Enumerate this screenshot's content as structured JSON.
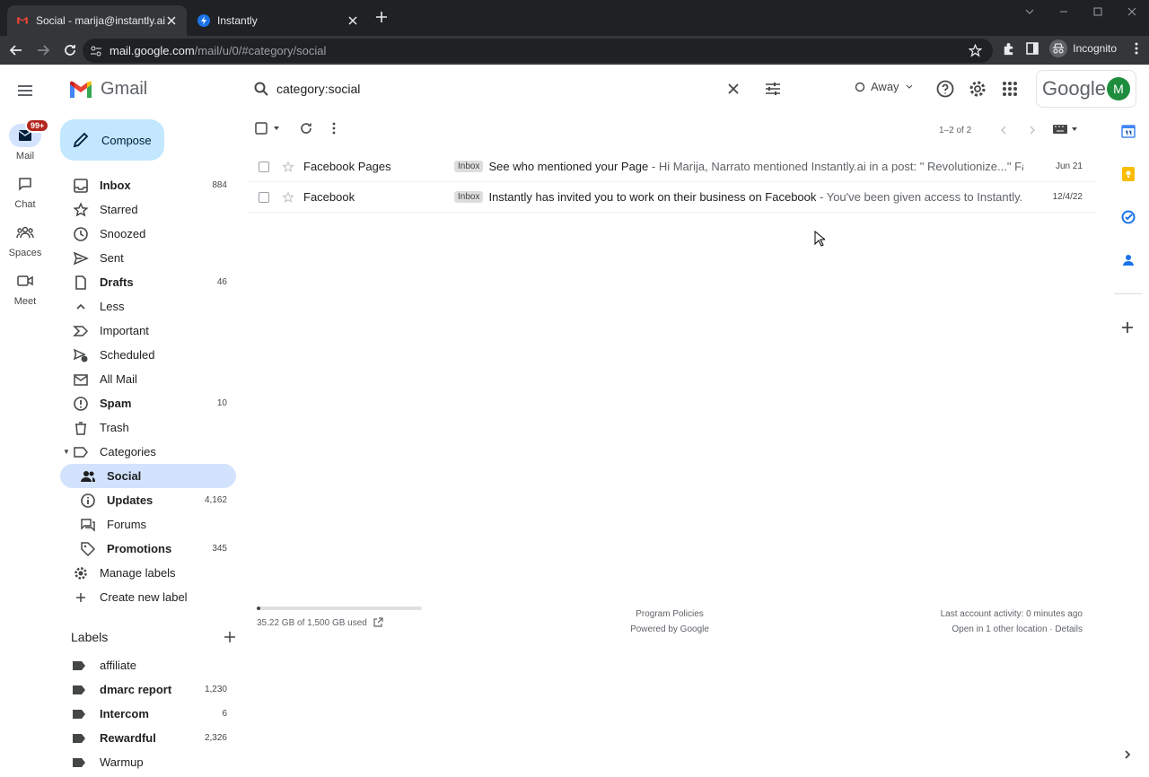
{
  "browser": {
    "tabs": [
      {
        "title": "Social - marija@instantly.ai - inst",
        "active": true
      },
      {
        "title": "Instantly",
        "active": false
      }
    ],
    "url_host": "mail.google.com",
    "url_path": "/mail/u/0/#category/social",
    "incognito_label": "Incognito"
  },
  "gmail": {
    "app_name": "Gmail",
    "search_query": "category:social",
    "status": "Away",
    "google_text": "Google",
    "avatar_letter": "M",
    "compose_label": "Compose",
    "rail": [
      {
        "label": "Mail",
        "badge": "99+"
      },
      {
        "label": "Chat"
      },
      {
        "label": "Spaces"
      },
      {
        "label": "Meet"
      }
    ],
    "sidebar": [
      {
        "label": "Inbox",
        "count": "884"
      },
      {
        "label": "Starred",
        "count": ""
      },
      {
        "label": "Snoozed",
        "count": ""
      },
      {
        "label": "Sent",
        "count": ""
      },
      {
        "label": "Drafts",
        "count": "46"
      },
      {
        "label": "Less",
        "count": ""
      },
      {
        "label": "Important",
        "count": ""
      },
      {
        "label": "Scheduled",
        "count": ""
      },
      {
        "label": "All Mail",
        "count": ""
      },
      {
        "label": "Spam",
        "count": "10"
      },
      {
        "label": "Trash",
        "count": ""
      },
      {
        "label": "Categories",
        "count": ""
      },
      {
        "label": "Social",
        "count": ""
      },
      {
        "label": "Updates",
        "count": "4,162"
      },
      {
        "label": "Forums",
        "count": ""
      },
      {
        "label": "Promotions",
        "count": "345"
      },
      {
        "label": "Manage labels",
        "count": ""
      },
      {
        "label": "Create new label",
        "count": ""
      }
    ],
    "labels_heading": "Labels",
    "labels": [
      {
        "label": "affiliate",
        "count": ""
      },
      {
        "label": "dmarc report",
        "count": "1,230"
      },
      {
        "label": "Intercom",
        "count": "6"
      },
      {
        "label": "Rewardful",
        "count": "2,326"
      },
      {
        "label": "Warmup",
        "count": ""
      }
    ],
    "pager": "1–2 of 2",
    "emails": [
      {
        "from": "Facebook Pages",
        "tag": "Inbox",
        "subject": "See who mentioned your Page",
        "snippet": " - Hi Marija, Narrato mentioned Instantly.ai in a post: \" Revolutionize...\" Faceb...",
        "date": "Jun 21"
      },
      {
        "from": "Facebook",
        "tag": "Inbox",
        "subject": "Instantly has invited you to work on their business on Facebook",
        "snippet": " - You've been given access to Instantly. Eti S...",
        "date": "12/4/22"
      }
    ],
    "footer": {
      "storage_text": "35.22 GB of 1,500 GB used",
      "storage_fraction": 0.023,
      "policies": "Program Policies",
      "powered": "Powered by Google",
      "activity": "Last account activity: 0 minutes ago",
      "other_location": "Open in 1 other location · Details"
    }
  }
}
